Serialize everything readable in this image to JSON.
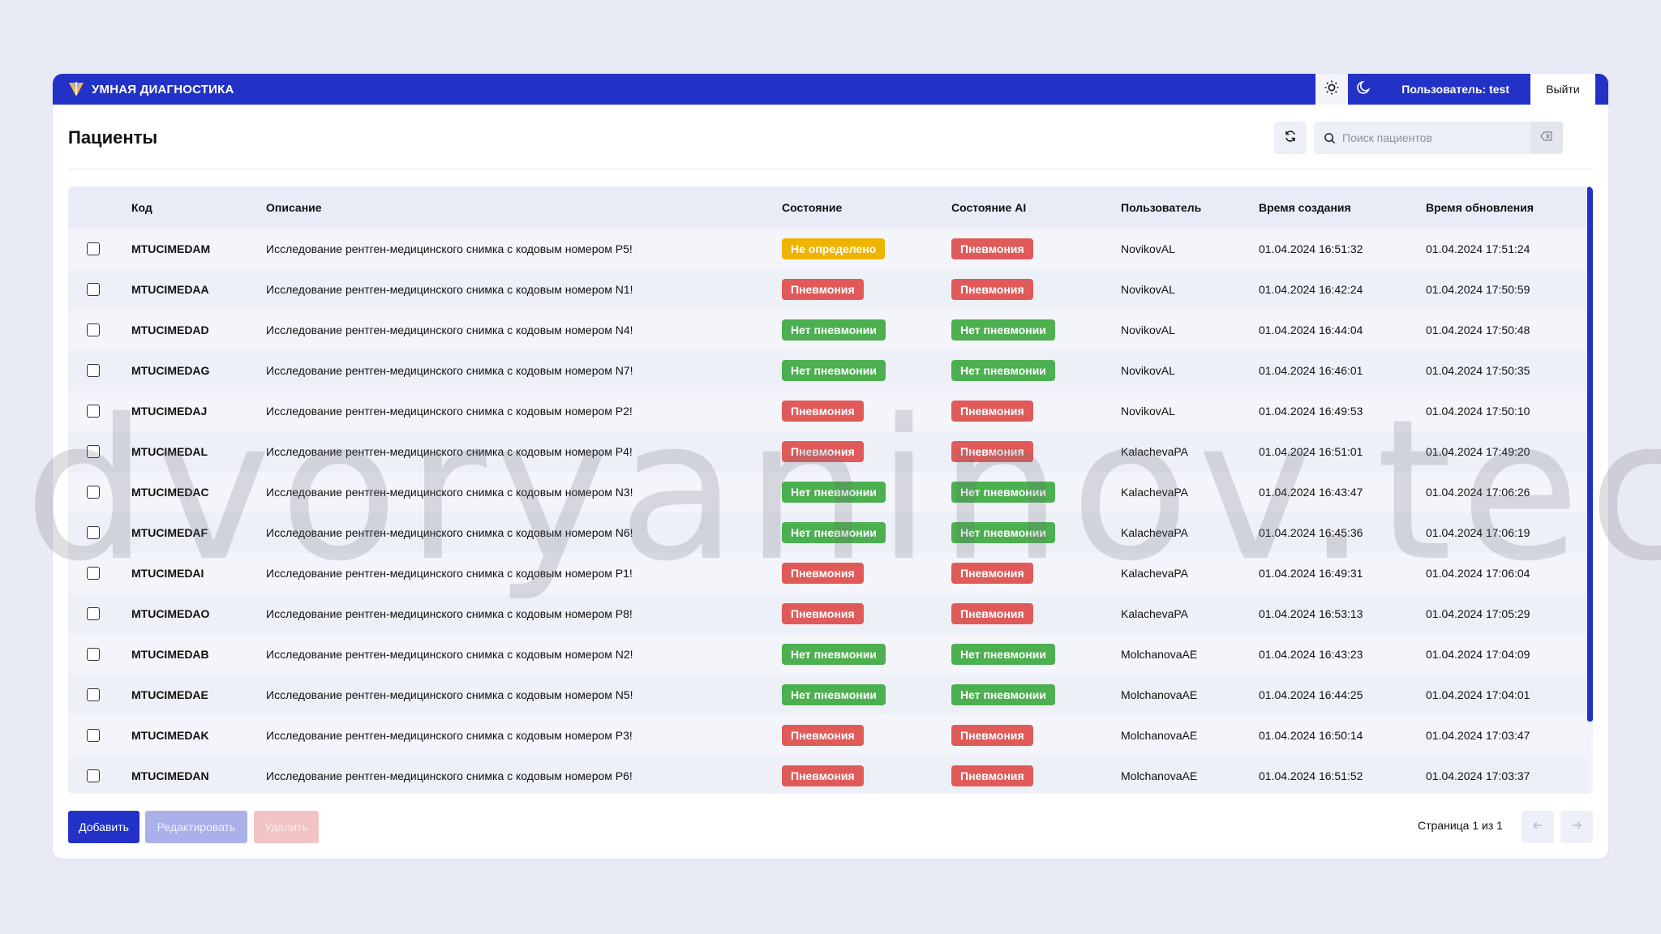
{
  "app": {
    "title": "УМНАЯ ДИАГНОСТИКА"
  },
  "header": {
    "user_label": "Пользователь: test",
    "logout_label": "Выйти"
  },
  "page": {
    "title": "Пациенты"
  },
  "search": {
    "placeholder": "Поиск пациентов",
    "value": ""
  },
  "table": {
    "columns": [
      "Код",
      "Описание",
      "Состояние",
      "Состояние AI",
      "Пользователь",
      "Время создания",
      "Время обновления"
    ],
    "rows": [
      {
        "code": "MTUCIMEDAM",
        "description": "Исследование рентген-медицинского снимка с кодовым номером P5!",
        "state": "Не определено",
        "state_color": "yellow",
        "ai_state": "Пневмония",
        "ai_color": "red",
        "user": "NovikovAL",
        "created": "01.04.2024 16:51:32",
        "updated": "01.04.2024 17:51:24"
      },
      {
        "code": "MTUCIMEDAA",
        "description": "Исследование рентген-медицинского снимка с кодовым номером N1!",
        "state": "Пневмония",
        "state_color": "red",
        "ai_state": "Пневмония",
        "ai_color": "red",
        "user": "NovikovAL",
        "created": "01.04.2024 16:42:24",
        "updated": "01.04.2024 17:50:59"
      },
      {
        "code": "MTUCIMEDAD",
        "description": "Исследование рентген-медицинского снимка с кодовым номером N4!",
        "state": "Нет пневмонии",
        "state_color": "green",
        "ai_state": "Нет пневмонии",
        "ai_color": "green",
        "user": "NovikovAL",
        "created": "01.04.2024 16:44:04",
        "updated": "01.04.2024 17:50:48"
      },
      {
        "code": "MTUCIMEDAG",
        "description": "Исследование рентген-медицинского снимка с кодовым номером N7!",
        "state": "Нет пневмонии",
        "state_color": "green",
        "ai_state": "Нет пневмонии",
        "ai_color": "green",
        "user": "NovikovAL",
        "created": "01.04.2024 16:46:01",
        "updated": "01.04.2024 17:50:35"
      },
      {
        "code": "MTUCIMEDAJ",
        "description": "Исследование рентген-медицинского снимка с кодовым номером P2!",
        "state": "Пневмония",
        "state_color": "red",
        "ai_state": "Пневмония",
        "ai_color": "red",
        "user": "NovikovAL",
        "created": "01.04.2024 16:49:53",
        "updated": "01.04.2024 17:50:10"
      },
      {
        "code": "MTUCIMEDAL",
        "description": "Исследование рентген-медицинского снимка с кодовым номером P4!",
        "state": "Пневмония",
        "state_color": "red",
        "ai_state": "Пневмония",
        "ai_color": "red",
        "user": "KalachevaPA",
        "created": "01.04.2024 16:51:01",
        "updated": "01.04.2024 17:49:20"
      },
      {
        "code": "MTUCIMEDAC",
        "description": "Исследование рентген-медицинского снимка с кодовым номером N3!",
        "state": "Нет пневмонии",
        "state_color": "green",
        "ai_state": "Нет пневмонии",
        "ai_color": "green",
        "user": "KalachevaPA",
        "created": "01.04.2024 16:43:47",
        "updated": "01.04.2024 17:06:26"
      },
      {
        "code": "MTUCIMEDAF",
        "description": "Исследование рентген-медицинского снимка с кодовым номером N6!",
        "state": "Нет пневмонии",
        "state_color": "green",
        "ai_state": "Нет пневмонии",
        "ai_color": "green",
        "user": "KalachevaPA",
        "created": "01.04.2024 16:45:36",
        "updated": "01.04.2024 17:06:19"
      },
      {
        "code": "MTUCIMEDAI",
        "description": "Исследование рентген-медицинского снимка с кодовым номером P1!",
        "state": "Пневмония",
        "state_color": "red",
        "ai_state": "Пневмония",
        "ai_color": "red",
        "user": "KalachevaPA",
        "created": "01.04.2024 16:49:31",
        "updated": "01.04.2024 17:06:04"
      },
      {
        "code": "MTUCIMEDAO",
        "description": "Исследование рентген-медицинского снимка с кодовым номером P8!",
        "state": "Пневмония",
        "state_color": "red",
        "ai_state": "Пневмония",
        "ai_color": "red",
        "user": "KalachevaPA",
        "created": "01.04.2024 16:53:13",
        "updated": "01.04.2024 17:05:29"
      },
      {
        "code": "MTUCIMEDAB",
        "description": "Исследование рентген-медицинского снимка с кодовым номером N2!",
        "state": "Нет пневмонии",
        "state_color": "green",
        "ai_state": "Нет пневмонии",
        "ai_color": "green",
        "user": "MolchanovaAE",
        "created": "01.04.2024 16:43:23",
        "updated": "01.04.2024 17:04:09"
      },
      {
        "code": "MTUCIMEDAE",
        "description": "Исследование рентген-медицинского снимка с кодовым номером N5!",
        "state": "Нет пневмонии",
        "state_color": "green",
        "ai_state": "Нет пневмонии",
        "ai_color": "green",
        "user": "MolchanovaAE",
        "created": "01.04.2024 16:44:25",
        "updated": "01.04.2024 17:04:01"
      },
      {
        "code": "MTUCIMEDAK",
        "description": "Исследование рентген-медицинского снимка с кодовым номером P3!",
        "state": "Пневмония",
        "state_color": "red",
        "ai_state": "Пневмония",
        "ai_color": "red",
        "user": "MolchanovaAE",
        "created": "01.04.2024 16:50:14",
        "updated": "01.04.2024 17:03:47"
      },
      {
        "code": "MTUCIMEDAN",
        "description": "Исследование рентген-медицинского снимка с кодовым номером P6!",
        "state": "Пневмония",
        "state_color": "red",
        "ai_state": "Пневмония",
        "ai_color": "red",
        "user": "MolchanovaAE",
        "created": "01.04.2024 16:51:52",
        "updated": "01.04.2024 17:03:37"
      }
    ]
  },
  "footer": {
    "add_label": "Добавить",
    "edit_label": "Редактировать",
    "delete_label": "Удалить",
    "page_info": "Страница 1 из 1"
  },
  "watermark": "dvoryaninov.tech",
  "icons": {
    "logo": "caduceus-shield-icon",
    "theme_light": "sun-icon",
    "theme_dark": "moon-icon",
    "refresh": "refresh-icon",
    "search": "search-icon",
    "clear": "backspace-clear-icon",
    "prev": "arrow-left-icon",
    "next": "arrow-right-icon"
  },
  "colors": {
    "primary": "#2232c7",
    "danger": "#e05a5a",
    "success": "#4caf50",
    "warning": "#efb400",
    "background": "#e8eaf6"
  }
}
